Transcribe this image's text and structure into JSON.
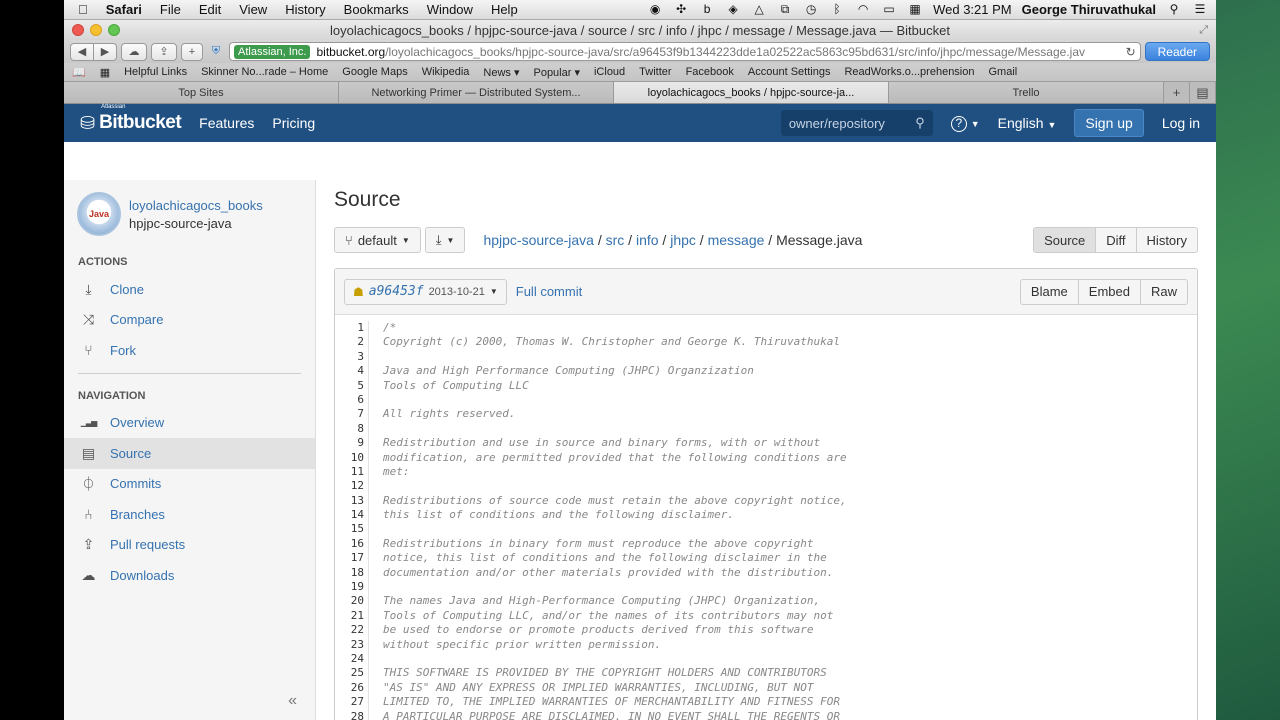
{
  "menubar": {
    "app": "Safari",
    "items": [
      "File",
      "Edit",
      "View",
      "History",
      "Bookmarks",
      "Window",
      "Help"
    ],
    "clock": "Wed 3:21 PM",
    "user": "George Thiruvathukal"
  },
  "window": {
    "title": "loyolachicagocs_books / hpjpc-source-java / source / src / info / jhpc / message / Message.java — Bitbucket"
  },
  "toolbar": {
    "ev_label": "Atlassian, Inc.",
    "url_domain": "bitbucket.org",
    "url_path": "/loyolachicagocs_books/hpjpc-source-java/src/a96453f9b1344223dde1a02522ac5863c95bd631/src/info/jhpc/message/Message.jav",
    "reader": "Reader"
  },
  "bookmarks": [
    "Helpful Links",
    "Skinner No...rade – Home",
    "Google Maps",
    "Wikipedia",
    "News ▾",
    "Popular ▾",
    "iCloud",
    "Twitter",
    "Facebook",
    "Account Settings",
    "ReadWorks.o...prehension",
    "Gmail"
  ],
  "tabs": [
    {
      "label": "Top Sites",
      "active": false
    },
    {
      "label": "Networking Primer — Distributed System...",
      "active": false
    },
    {
      "label": "loyolachicagocs_books / hpjpc-source-ja...",
      "active": true
    },
    {
      "label": "Trello",
      "active": false
    }
  ],
  "bbnav": {
    "brand_small": "Atlassian",
    "brand": "Bitbucket",
    "features": "Features",
    "pricing": "Pricing",
    "search_placeholder": "owner/repository",
    "help": "?",
    "language": "English",
    "signup": "Sign up",
    "login": "Log in"
  },
  "sidebar": {
    "owner": "loyolachicagocs_books",
    "repo": "hpjpc-source-java",
    "avatar_text": "Java",
    "actions_title": "ACTIONS",
    "actions": [
      {
        "label": "Clone",
        "icon": "clone-icon",
        "glyph": "⤓"
      },
      {
        "label": "Compare",
        "icon": "compare-icon",
        "glyph": "⤨"
      },
      {
        "label": "Fork",
        "icon": "fork-icon",
        "glyph": "⑂"
      }
    ],
    "navigation_title": "NAVIGATION",
    "navigation": [
      {
        "label": "Overview",
        "icon": "overview-icon",
        "glyph": "▁▃▅",
        "active": false
      },
      {
        "label": "Source",
        "icon": "source-icon",
        "glyph": "▤",
        "active": true
      },
      {
        "label": "Commits",
        "icon": "commits-icon",
        "glyph": "⏀",
        "active": false
      },
      {
        "label": "Branches",
        "icon": "branches-icon",
        "glyph": "⑃",
        "active": false
      },
      {
        "label": "Pull requests",
        "icon": "pull-requests-icon",
        "glyph": "⇪",
        "active": false
      },
      {
        "label": "Downloads",
        "icon": "downloads-icon",
        "glyph": "☁",
        "active": false
      }
    ],
    "collapse": "«"
  },
  "main": {
    "title": "Source",
    "branch": "default",
    "breadcrumb": [
      "hpjpc-source-java",
      "src",
      "info",
      "jhpc",
      "message"
    ],
    "filename": "Message.java",
    "views": [
      {
        "label": "Source",
        "selected": true
      },
      {
        "label": "Diff",
        "selected": false
      },
      {
        "label": "History",
        "selected": false
      }
    ],
    "commit_hash": "a96453f",
    "commit_date": "2013-10-21",
    "full_commit": "Full commit",
    "file_actions": [
      "Blame",
      "Embed",
      "Raw"
    ]
  },
  "code": [
    "/*",
    "Copyright (c) 2000, Thomas W. Christopher and George K. Thiruvathukal",
    "",
    "Java and High Performance Computing (JHPC) Organzization",
    "Tools of Computing LLC",
    "",
    "All rights reserved.",
    "",
    "Redistribution and use in source and binary forms, with or without",
    "modification, are permitted provided that the following conditions are",
    "met:",
    "",
    "Redistributions of source code must retain the above copyright notice,",
    "this list of conditions and the following disclaimer.",
    "",
    "Redistributions in binary form must reproduce the above copyright",
    "notice, this list of conditions and the following disclaimer in the",
    "documentation and/or other materials provided with the distribution.",
    "",
    "The names Java and High-Performance Computing (JHPC) Organization,",
    "Tools of Computing LLC, and/or the names of its contributors may not",
    "be used to endorse or promote products derived from this software",
    "without specific prior written permission.",
    "",
    "THIS SOFTWARE IS PROVIDED BY THE COPYRIGHT HOLDERS AND CONTRIBUTORS",
    "\"AS IS\" AND ANY EXPRESS OR IMPLIED WARRANTIES, INCLUDING, BUT NOT",
    "LIMITED TO, THE IMPLIED WARRANTIES OF MERCHANTABILITY AND FITNESS FOR",
    "A PARTICULAR PURPOSE ARE DISCLAIMED. IN NO EVENT SHALL THE REGENTS OR"
  ],
  "colors": {
    "bitbucket_blue": "#205081",
    "link": "#3572b0",
    "signup": "#3572b0"
  }
}
